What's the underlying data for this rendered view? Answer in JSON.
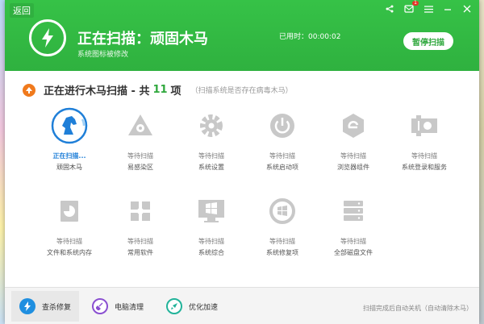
{
  "header": {
    "back_label": "返回",
    "title": "正在扫描：顽固木马",
    "subtitle": "系统图标被修改",
    "elapsed_label": "已用时：00:00:02",
    "pause_button": "暂停扫描",
    "badge": "1"
  },
  "scan": {
    "title": "正在进行木马扫描 - 共",
    "count": "11",
    "unit": "项",
    "hint": "（扫描系统是否存在病毒木马）"
  },
  "items": [
    {
      "status": "正在扫描...",
      "name": "顽固木马",
      "icon": "horse-icon"
    },
    {
      "status": "等待扫描",
      "name": "易感染区",
      "icon": "biohazard-icon"
    },
    {
      "status": "等待扫描",
      "name": "系统设置",
      "icon": "gear-icon"
    },
    {
      "status": "等待扫描",
      "name": "系统启动项",
      "icon": "power-icon"
    },
    {
      "status": "等待扫描",
      "name": "浏览器组件",
      "icon": "browser-icon"
    },
    {
      "status": "等待扫描",
      "name": "系统登录和服务",
      "icon": "service-icon"
    },
    {
      "status": "等待扫描",
      "name": "文件和系统内存",
      "icon": "pie-icon"
    },
    {
      "status": "等待扫描",
      "name": "常用软件",
      "icon": "software-icon"
    },
    {
      "status": "等待扫描",
      "name": "系统综合",
      "icon": "windows-icon"
    },
    {
      "status": "等待扫描",
      "name": "系统修复项",
      "icon": "repair-icon"
    },
    {
      "status": "等待扫描",
      "name": "全部磁盘文件",
      "icon": "disk-icon"
    }
  ],
  "bottom": {
    "tabs": [
      {
        "label": "查杀修复",
        "icon": "lightning-icon",
        "color": "#1f8fe0"
      },
      {
        "label": "电脑清理",
        "icon": "broom-icon",
        "color": "#8a4fd1"
      },
      {
        "label": "优化加速",
        "icon": "rocket-icon",
        "color": "#22b39a"
      }
    ],
    "note": "扫描完成后自动关机（自动清除木马）"
  },
  "colors": {
    "header_green": "#34bd45",
    "accent_green": "#2fa83d",
    "active_blue": "#1f7fd8",
    "icon_gray": "#c8c8c8",
    "scan_orange": "#f07a1d"
  }
}
